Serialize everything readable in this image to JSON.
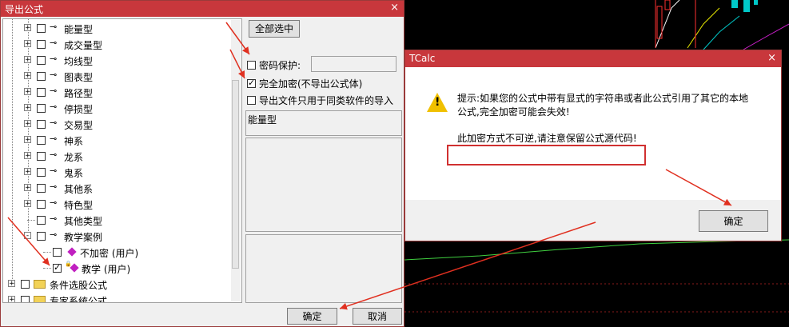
{
  "export_dialog": {
    "title": "导出公式",
    "close": "×",
    "tree_items": [
      {
        "label": "能量型",
        "level": 1,
        "expander": "+",
        "checked": false,
        "icon": "key-icon"
      },
      {
        "label": "成交量型",
        "level": 1,
        "expander": "+",
        "checked": false,
        "icon": "key-icon"
      },
      {
        "label": "均线型",
        "level": 1,
        "expander": "+",
        "checked": false,
        "icon": "key-icon"
      },
      {
        "label": "图表型",
        "level": 1,
        "expander": "+",
        "checked": false,
        "icon": "key-icon"
      },
      {
        "label": "路径型",
        "level": 1,
        "expander": "+",
        "checked": false,
        "icon": "key-icon"
      },
      {
        "label": "停损型",
        "level": 1,
        "expander": "+",
        "checked": false,
        "icon": "key-icon"
      },
      {
        "label": "交易型",
        "level": 1,
        "expander": "+",
        "checked": false,
        "icon": "key-icon"
      },
      {
        "label": "神系",
        "level": 1,
        "expander": "+",
        "checked": false,
        "icon": "key-icon"
      },
      {
        "label": "龙系",
        "level": 1,
        "expander": "+",
        "checked": false,
        "icon": "key-icon"
      },
      {
        "label": "鬼系",
        "level": 1,
        "expander": "+",
        "checked": false,
        "icon": "key-icon"
      },
      {
        "label": "其他系",
        "level": 1,
        "expander": "+",
        "checked": false,
        "icon": "key-icon"
      },
      {
        "label": "特色型",
        "level": 1,
        "expander": "+",
        "checked": false,
        "icon": "key-icon"
      },
      {
        "label": "其他类型",
        "level": 1,
        "expander": "",
        "checked": false,
        "icon": "key-icon"
      },
      {
        "label": "教学案例",
        "level": 1,
        "expander": "-",
        "checked": false,
        "icon": "key-icon"
      },
      {
        "label": "不加密 (用户)",
        "level": 2,
        "expander": "",
        "checked": false,
        "icon": "diamond-icon"
      },
      {
        "label": "教学 (用户)",
        "level": 2,
        "expander": "",
        "checked": true,
        "icon": "lock-diamond-icon"
      },
      {
        "label": "条件选股公式",
        "level": 0,
        "expander": "+",
        "checked": false,
        "icon": "folder-icon"
      },
      {
        "label": "专家系统公式",
        "level": 0,
        "expander": "+",
        "checked": false,
        "icon": "folder-icon"
      }
    ],
    "select_all": "全部选中",
    "password_label": "密码保护:",
    "password_value": "",
    "password_checked": false,
    "full_encrypt_label": "完全加密(不导出公式体)",
    "full_encrypt_checked": true,
    "same_software_label": "导出文件只用于同类软件的导入",
    "same_software_checked": false,
    "formula_name": "能量型",
    "ok": "确定",
    "cancel": "取消"
  },
  "tcalc_dialog": {
    "title": "TCalc",
    "close": "×",
    "message_line1": "提示:如果您的公式中带有显式的字符串或者此公式引用了其它的本地",
    "message_line2": "公式,完全加密可能会失效!",
    "warning_text": "此加密方式不可逆,请注意保留公式源代码!",
    "ok": "确定"
  },
  "colors": {
    "title_bar": "#c8373c",
    "annotation_arrow": "#e03020",
    "chart_bg": "#000000"
  }
}
